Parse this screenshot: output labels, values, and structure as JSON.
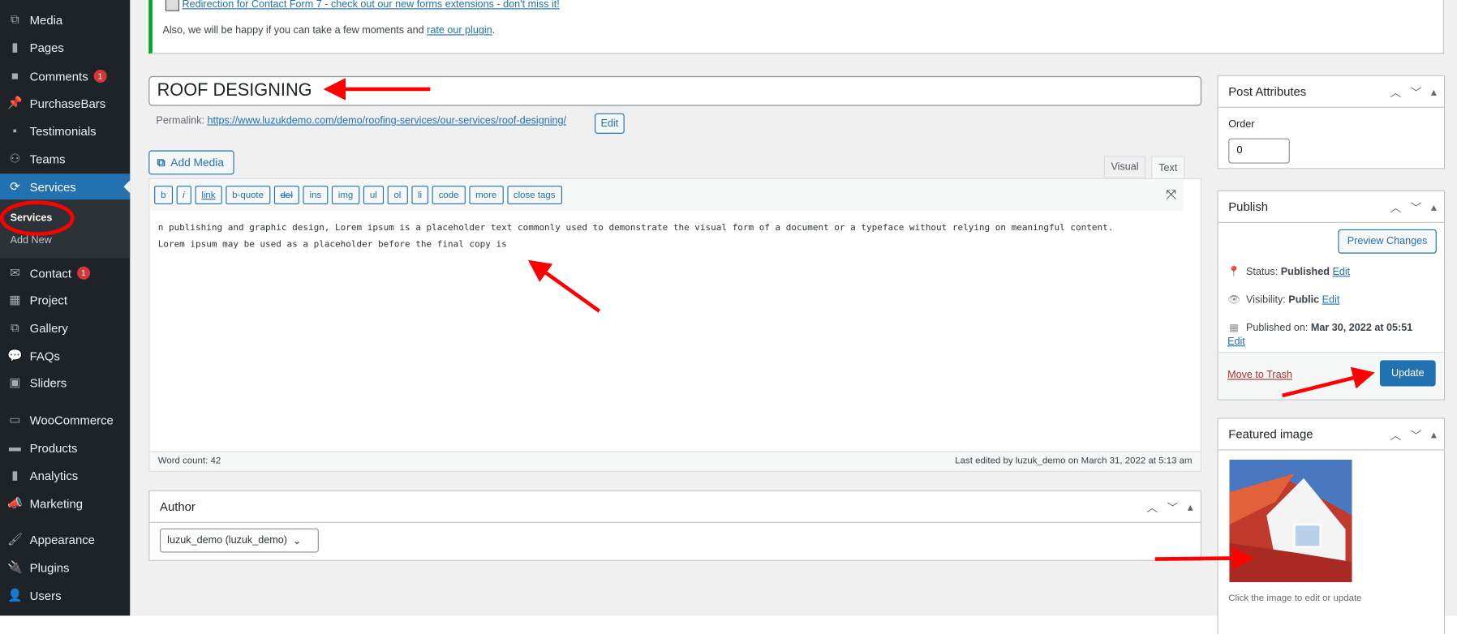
{
  "sidebar": {
    "items": [
      {
        "label": "Media",
        "icon": "media-icon"
      },
      {
        "label": "Pages",
        "icon": "pages-icon"
      },
      {
        "label": "Comments",
        "icon": "comments-icon",
        "badge": "1"
      },
      {
        "label": "PurchaseBars",
        "icon": "pin-icon"
      },
      {
        "label": "Testimonials",
        "icon": "testimonials-icon"
      },
      {
        "label": "Teams",
        "icon": "teams-icon"
      },
      {
        "label": "Services",
        "icon": "services-icon",
        "active": true
      },
      {
        "label": "Contact",
        "icon": "mail-icon",
        "badge": "1"
      },
      {
        "label": "Project",
        "icon": "project-icon"
      },
      {
        "label": "Gallery",
        "icon": "gallery-icon"
      },
      {
        "label": "FAQs",
        "icon": "faq-icon"
      },
      {
        "label": "Sliders",
        "icon": "sliders-icon"
      },
      {
        "label": "WooCommerce",
        "icon": "woocommerce-icon"
      },
      {
        "label": "Products",
        "icon": "products-icon"
      },
      {
        "label": "Analytics",
        "icon": "analytics-icon"
      },
      {
        "label": "Marketing",
        "icon": "marketing-icon"
      },
      {
        "label": "Appearance",
        "icon": "appearance-icon"
      },
      {
        "label": "Plugins",
        "icon": "plugins-icon"
      },
      {
        "label": "Users",
        "icon": "users-icon"
      }
    ],
    "submenu": [
      {
        "label": "Services",
        "current": true
      },
      {
        "label": "Add New"
      }
    ]
  },
  "notice": {
    "link": "Redirection for Contact Form 7 - check out our new forms extensions - don't miss it!",
    "text": "Also, we will be happy if you can take a few moments and",
    "rate_link": "rate our plugin",
    "period": "."
  },
  "post": {
    "title": "ROOF DESIGNING",
    "permalink_label": "Permalink:",
    "permalink": "https://www.luzukdemo.com/demo/roofing-services/our-services/roof-designing/",
    "permalink_edit": "Edit"
  },
  "editor": {
    "add_media": "Add Media",
    "tabs": [
      "Visual",
      "Text"
    ],
    "active_tab": "Text",
    "quicktags": [
      "b",
      "i",
      "link",
      "b-quote",
      "del",
      "ins",
      "img",
      "ul",
      "ol",
      "li",
      "code",
      "more",
      "close tags"
    ],
    "content_line1": "n publishing and graphic design, Lorem ipsum is a placeholder text commonly used to demonstrate the visual form of a document or a typeface without relying on meaningful content.",
    "content_line2": "Lorem ipsum may be used as a placeholder before the final copy is",
    "word_count": "Word count: 42",
    "last_edited": "Last edited by luzuk_demo on March 31, 2022 at 5:13 am"
  },
  "author": {
    "title": "Author",
    "selected": "luzuk_demo (luzuk_demo)"
  },
  "post_attributes": {
    "title": "Post Attributes",
    "order_label": "Order",
    "order_value": "0"
  },
  "publish": {
    "title": "Publish",
    "preview": "Preview Changes",
    "status_label": "Status:",
    "status": "Published",
    "visibility_label": "Visibility:",
    "visibility": "Public",
    "published_label": "Published on:",
    "published_on": "Mar 30, 2022 at 05:51",
    "edit": "Edit",
    "trash": "Move to Trash",
    "update": "Update"
  },
  "featured": {
    "title": "Featured image",
    "hint": "Click the image to edit or update"
  },
  "colors": {
    "sidebar": "#1d2327",
    "accent": "#2271b1",
    "badge": "#d63638",
    "annotation": "#ff0000"
  }
}
